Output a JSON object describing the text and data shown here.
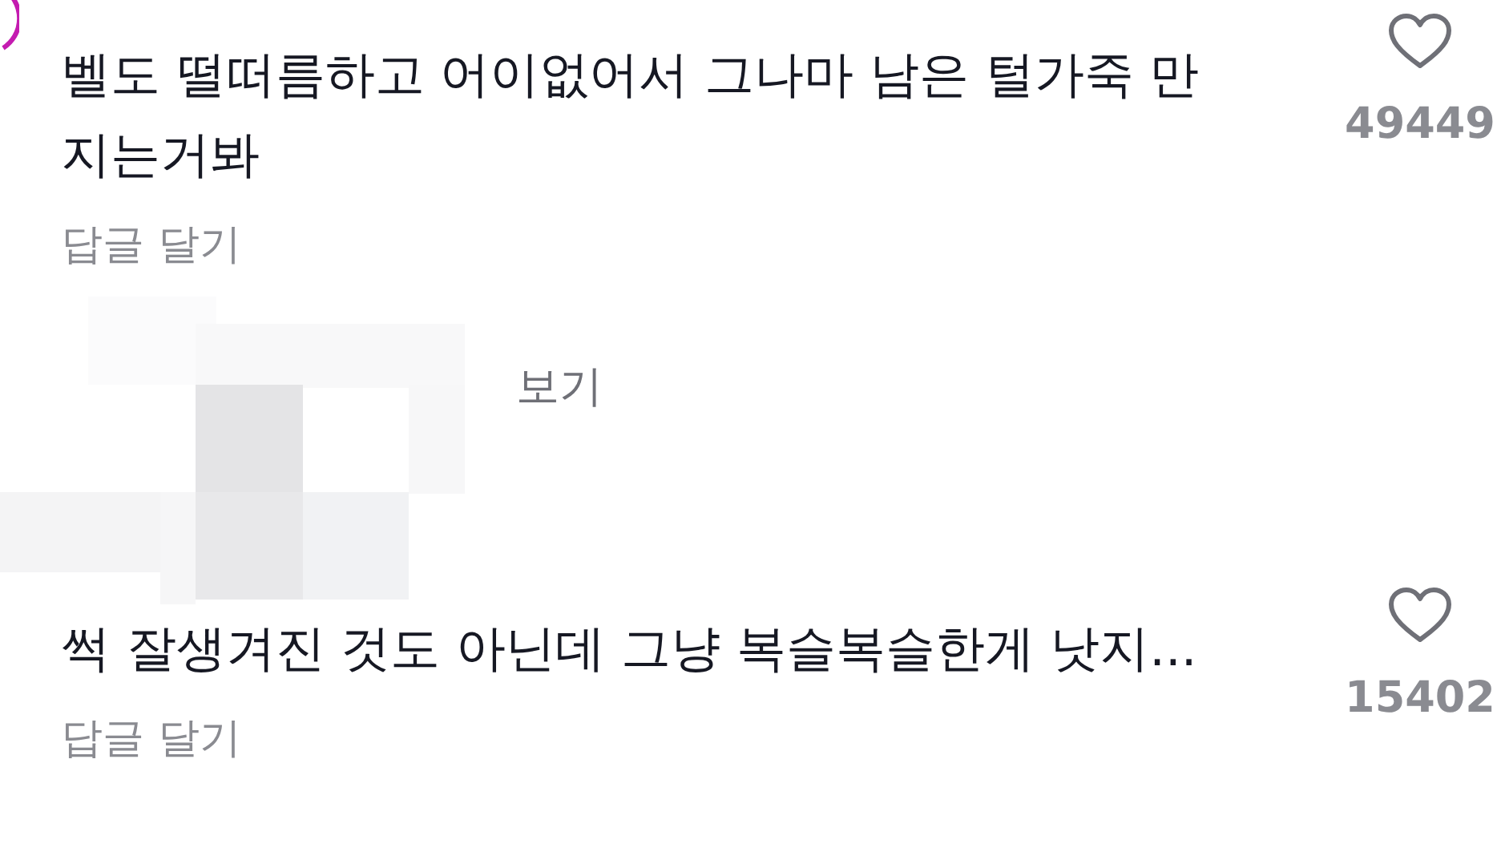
{
  "comments": [
    {
      "text": "벨도 떨떠름하고 어이없어서 그나마 남은 털가죽 만지는거봐",
      "like_count": "49449",
      "reply_action": "답글 달기",
      "liked": false
    },
    {
      "text": "썩 잘생겨진 것도 아닌데 그냥 복슬복슬한게 낫지...",
      "like_count": "15402",
      "reply_action": "답글 달기",
      "liked": false
    }
  ],
  "more_replies": {
    "label": "보기"
  }
}
